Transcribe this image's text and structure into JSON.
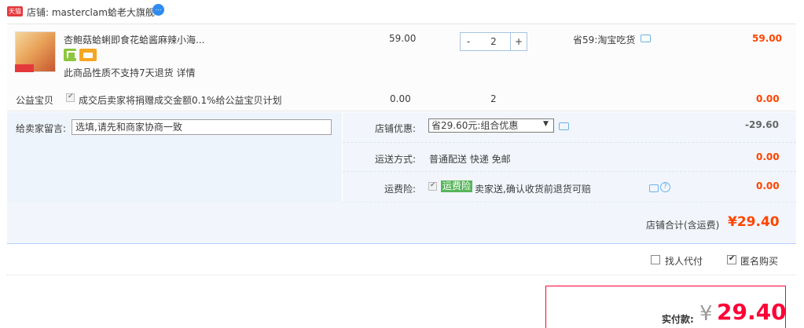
{
  "shop": {
    "badge": "天猫",
    "label": "店铺: masterclam蛤老大旗舰",
    "ww_icon": "aliwangwang-icon"
  },
  "item": {
    "title": "杏鲍菇蛤蜊即食花蛤酱麻辣小海...",
    "return_note": "此商品性质不支持7天退货 详情",
    "price": "59.00",
    "qty_minus": "-",
    "qty": "2",
    "qty_plus": "+",
    "promo": "省59:淘宝吃货",
    "total": "59.00"
  },
  "charity": {
    "label": "公益宝贝",
    "text": "成交后卖家将捐赠成交金额0.1%给公益宝贝计划",
    "price": "0.00",
    "qty": "2",
    "total": "0.00"
  },
  "options": {
    "memo_label": "给卖家留言:",
    "memo_placeholder": "选填,请先和商家协商一致",
    "discount_label": "店铺优惠:",
    "discount_value": "省29.60元:组合优惠",
    "discount_amount": "-29.60",
    "ship_label": "运送方式:",
    "ship_text": "普通配送 快递 免邮",
    "ship_amount": "0.00",
    "ins_label": "运费险:",
    "ins_badge": "运费险",
    "ins_text": "卖家送,确认收货前退货可赔",
    "ins_amount": "0.00"
  },
  "subtotal": {
    "label": "店铺合计(含运费)",
    "amount": "¥29.40"
  },
  "extras": {
    "proxy_label": "找人代付",
    "anon_label": "匿名购买"
  },
  "pay": {
    "label": "实付款:",
    "yen": "¥",
    "amount": "29.40"
  },
  "colors": {
    "accent_red": "#ff0036",
    "price_red": "#f40",
    "tmall_red": "#e4393c",
    "insurance_green": "#58b55b"
  }
}
